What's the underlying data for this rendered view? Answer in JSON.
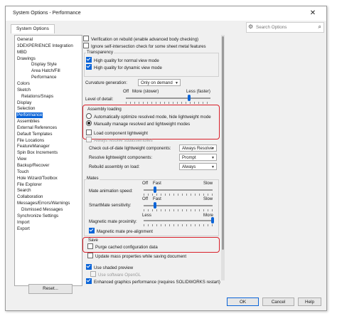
{
  "window": {
    "title": "System Options - Performance",
    "close_glyph": "✕"
  },
  "tab": {
    "label": "System Options"
  },
  "search": {
    "placeholder": "Search Options",
    "settings_icon": "⚙",
    "search_icon": "⌕"
  },
  "sidebar": {
    "selected": "Performance",
    "items": [
      {
        "label": "General",
        "level": 0
      },
      {
        "label": "3DEXPERIENCE Integration",
        "level": 0
      },
      {
        "label": "MBD",
        "level": 0
      },
      {
        "label": "Drawings",
        "level": 0
      },
      {
        "label": "Display Style",
        "level": 2
      },
      {
        "label": "Area Hatch/Fill",
        "level": 2
      },
      {
        "label": "Performance",
        "level": 2
      },
      {
        "label": "Colors",
        "level": 0
      },
      {
        "label": "Sketch",
        "level": 0
      },
      {
        "label": "Relations/Snaps",
        "level": 1
      },
      {
        "label": "Display",
        "level": 0
      },
      {
        "label": "Selection",
        "level": 0
      },
      {
        "label": "Performance",
        "level": 0
      },
      {
        "label": "Assemblies",
        "level": 0
      },
      {
        "label": "External References",
        "level": 0
      },
      {
        "label": "Default Templates",
        "level": 0
      },
      {
        "label": "File Locations",
        "level": 0
      },
      {
        "label": "FeatureManager",
        "level": 0
      },
      {
        "label": "Spin Box Increments",
        "level": 0
      },
      {
        "label": "View",
        "level": 0
      },
      {
        "label": "Backup/Recover",
        "level": 0
      },
      {
        "label": "Touch",
        "level": 0
      },
      {
        "label": "Hole Wizard/Toolbox",
        "level": 0
      },
      {
        "label": "File Explorer",
        "level": 0
      },
      {
        "label": "Search",
        "level": 0
      },
      {
        "label": "Collaboration",
        "level": 0
      },
      {
        "label": "Messages/Errors/Warnings",
        "level": 0
      },
      {
        "label": "Dismissed Messages",
        "level": 1
      },
      {
        "label": "Synchronize Settings",
        "level": 0
      },
      {
        "label": "Import",
        "level": 0
      },
      {
        "label": "Export",
        "level": 0
      }
    ]
  },
  "reset_button": "Reset...",
  "options": {
    "verification_on_rebuild": {
      "label": "Verification on rebuild (enable advanced body checking)",
      "checked": false
    },
    "ignore_self_intersection": {
      "label": "Ignore self-intersection check for some sheet metal features",
      "checked": false
    },
    "transparency": {
      "label": "Transparency",
      "hq_normal": {
        "label": "High quality for normal view mode",
        "checked": true
      },
      "hq_dynamic": {
        "label": "High quality for dynamic view mode",
        "checked": true
      }
    },
    "curvature_generation": {
      "label": "Curvature generation:",
      "value": "Only on demand"
    },
    "level_of_detail": {
      "label": "Level of detail:",
      "off": "Off",
      "more": "More (slower)",
      "less": "Less (faster)",
      "level_percent": 75
    },
    "assembly_loading": {
      "label": "Assembly loading",
      "auto_optimize": {
        "label": "Automatically optimize resolved mode, hide lightweight mode",
        "selected": false
      },
      "manually_manage": {
        "label": "Manually manage resolved and lightweight modes",
        "selected": true
      },
      "load_lightweight": {
        "label": "Load component lightweight",
        "checked": false
      },
      "always_resolve": {
        "label": "Always resolve subassemblies",
        "checked": false
      },
      "check_out_of_date": {
        "label": "Check out-of-date lightweight components:",
        "value": "Always Resolve"
      },
      "resolve_lightweight": {
        "label": "Resolve lightweight components:",
        "value": "Prompt"
      },
      "rebuild_on_load": {
        "label": "Rebuild assembly on load:",
        "value": "Always"
      }
    },
    "mates": {
      "label": "Mates",
      "animation_speed": {
        "label": "Mate animation speed:",
        "off": "Off",
        "fast": "Fast",
        "slow": "Slow",
        "level_percent": 17
      },
      "smartmate_sensitivity": {
        "label": "SmartMate sensitivity:",
        "off": "Off",
        "fast": "Fast",
        "slow": "Slow",
        "level_percent": 17
      },
      "magnetic_proximity": {
        "label": "Magnetic mate proximity:",
        "less": "Less",
        "more": "More",
        "level_percent": 100
      },
      "magnetic_prealignment": {
        "label": "Magnetic mate pre-alignment",
        "checked": true
      }
    },
    "save": {
      "label": "Save",
      "purge_cached": {
        "label": "Purge cached configuration data",
        "checked": false
      },
      "update_mass": {
        "label": "Update mass properties while saving document",
        "checked": false
      }
    },
    "use_shaded_preview": {
      "label": "Use shaded preview",
      "checked": true
    },
    "use_software_opengl": {
      "label": "Use software OpenGL",
      "checked": false
    },
    "enhanced_graphics": {
      "label": "Enhanced graphics performance (requires SOLIDWORKS restart)",
      "checked": true
    }
  },
  "buttons": {
    "ok": "OK",
    "cancel": "Cancel",
    "help": "Help"
  },
  "colors": {
    "accent": "#0a64d8",
    "highlight": "#d9202a"
  }
}
